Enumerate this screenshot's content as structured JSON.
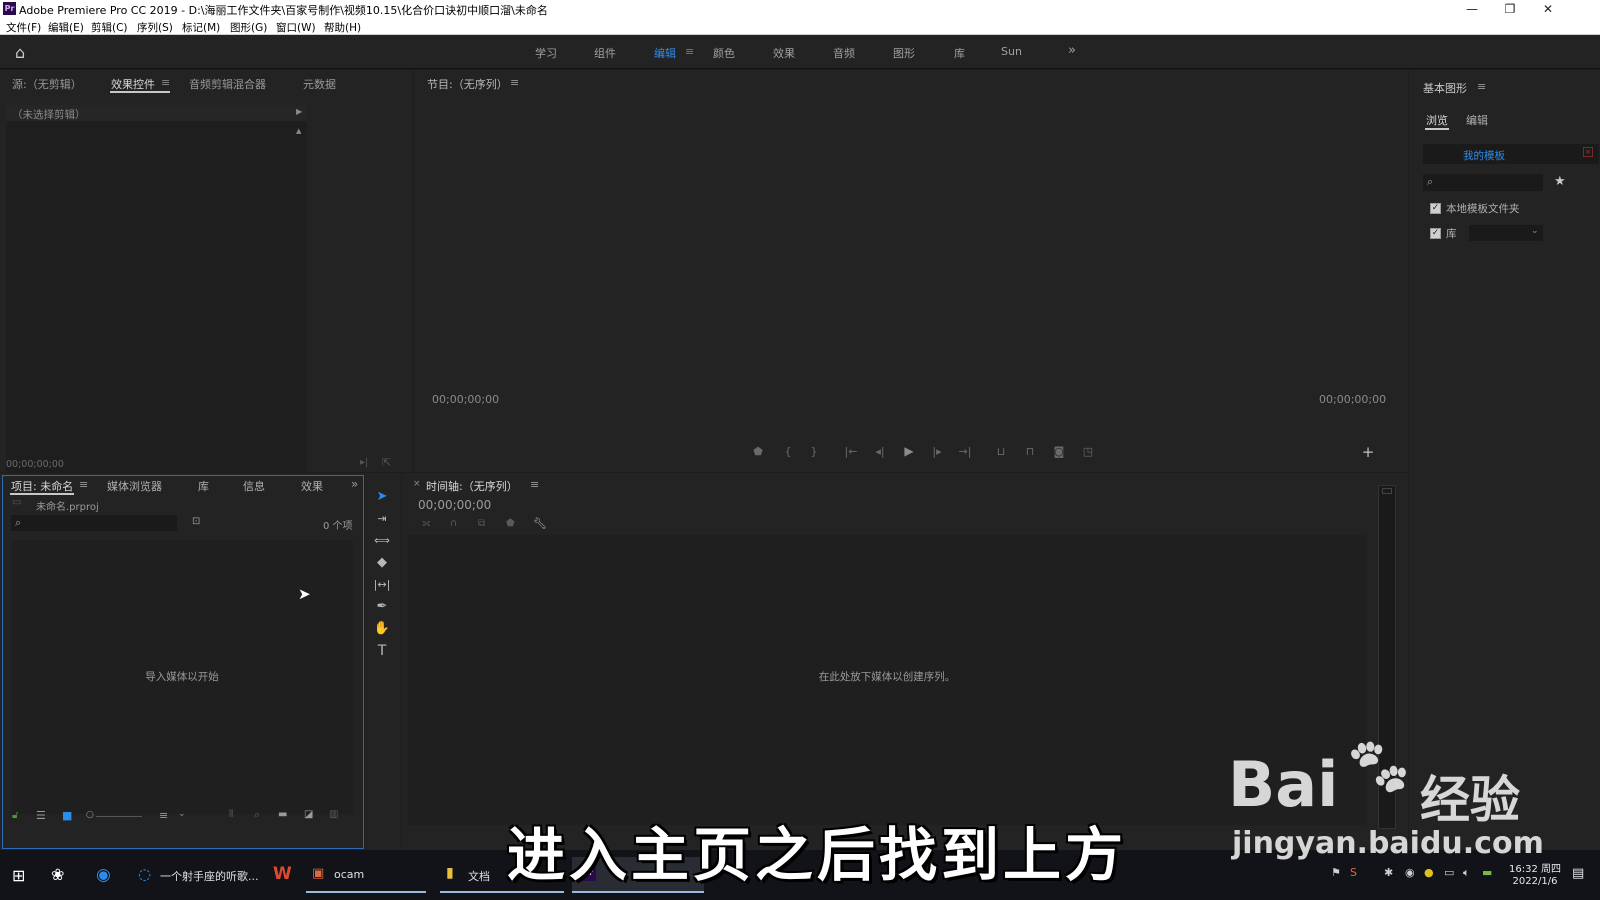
{
  "window": {
    "title": "Adobe Premiere Pro CC 2019 - D:\\海丽工作文件夹\\百家号制作\\视频10.15\\化合价口诀初中顺口溜\\未命名",
    "app_icon": "Pr",
    "minimize": "—",
    "restore": "❐",
    "close": "✕"
  },
  "menu": [
    "文件(F)",
    "编辑(E)",
    "剪辑(C)",
    "序列(S)",
    "标记(M)",
    "图形(G)",
    "窗口(W)",
    "帮助(H)"
  ],
  "workspaces": {
    "items": [
      "学习",
      "组件",
      "编辑",
      "颜色",
      "效果",
      "音频",
      "图形",
      "库",
      "Sun"
    ],
    "active": "编辑",
    "more": "»"
  },
  "source_panel": {
    "tabs": [
      "源:（无剪辑）",
      "效果控件",
      "音频剪辑混合器",
      "元数据"
    ],
    "active_tab": "效果控件",
    "no_clip": "（未选择剪辑）",
    "timecode": "00;00;00;00"
  },
  "program_panel": {
    "title": "节目:（无序列）",
    "timecode_left": "00;00;00;00",
    "timecode_right": "00;00;00;00"
  },
  "essential_graphics": {
    "title": "基本图形",
    "tabs": [
      "浏览",
      "编辑"
    ],
    "active_tab": "浏览",
    "my_templates": "我的模板",
    "local_templates": "本地模板文件夹",
    "library": "库"
  },
  "project_panel": {
    "tabs": [
      "项目: 未命名",
      "媒体浏览器",
      "库",
      "信息",
      "效果"
    ],
    "active_tab": "项目: 未命名",
    "file": "未命名.prproj",
    "item_count": "0 个项",
    "empty_hint": "导入媒体以开始"
  },
  "timeline_panel": {
    "title": "时间轴:（无序列）",
    "timecode": "00;00;00;00",
    "empty_hint": "在此处放下媒体以创建序列。"
  },
  "taskbar": {
    "items": [
      "一个射手座的听歌...",
      "ocam",
      "文档"
    ],
    "time": "16:32 周四",
    "date": "2022/1/6"
  },
  "subtitle": "进入主页之后找到上方",
  "watermark": {
    "brand": "Bai",
    "brand_suffix": "经验",
    "url": "jingyan.baidu.com"
  },
  "colors": {
    "accent": "#2d8ceb",
    "panel_bg": "#232323",
    "panel_dark": "#1a1a1a"
  }
}
